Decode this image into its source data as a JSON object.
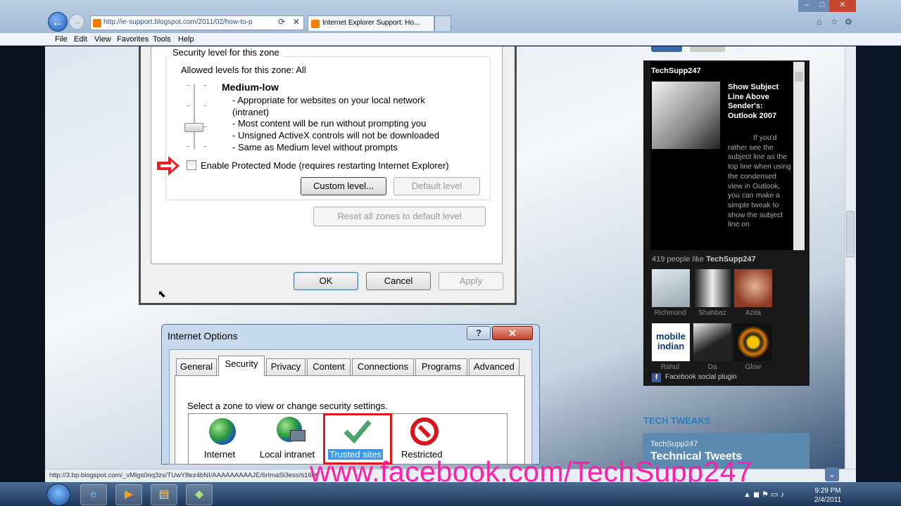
{
  "browser": {
    "address": "http://ie-support.blogspot.com/2011/02/how-to-p",
    "tab_title": "Internet Explorer Support: Ho...",
    "menu": [
      "File",
      "Edit",
      "View",
      "Favorites",
      "Tools",
      "Help"
    ],
    "window_controls": [
      "minimize-icon",
      "maximize-icon",
      "close-icon"
    ]
  },
  "dialog1": {
    "group_title": "Security level for this zone",
    "allowed": "Allowed levels for this zone: All",
    "level_name": "Medium-low",
    "bullets": [
      "- Appropriate for websites on your local network",
      "(intranet)",
      "- Most content will be run without prompting you",
      "- Unsigned ActiveX controls will not be downloaded",
      "- Same as Medium level without prompts"
    ],
    "checkbox_label": "Enable Protected Mode (requires restarting Internet Explorer)",
    "custom_level": "Custom level...",
    "default_level": "Default level",
    "reset_all": "Reset all zones to default level",
    "ok": "OK",
    "cancel": "Cancel",
    "apply": "Apply"
  },
  "dialog2": {
    "title": "Internet Options",
    "help": "?",
    "close": "✕",
    "tabs": [
      "General",
      "Security",
      "Privacy",
      "Content",
      "Connections",
      "Programs",
      "Advanced"
    ],
    "prompt": "Select a zone to view or change security settings.",
    "zones": [
      "Internet",
      "Local intranet",
      "Trusted sites",
      "Restricted"
    ]
  },
  "sidebar": {
    "fb_title": "TechSupp247",
    "post_title": "Show Subject Line Above Sender's: Outlook 2007",
    "post_body": "If you'd rather see the subject line as the top line when using the condensed view in Outlook, you can make a simple tweak to show the subject line on",
    "likes_count": "419 people like",
    "likes_page": "TechSupp247",
    "fans": [
      "Richmond",
      "Shahbaz",
      "Azita",
      "Rahul",
      "Da",
      "Glow"
    ],
    "fan_tile_text": "mobile indian",
    "plugin_label": "Facebook social plugin",
    "tech_tweaks": "TECH TWEAKS",
    "tw_user": "TechSupp247",
    "tw_title": "Technical Tweets"
  },
  "status": {
    "url": "http://3.bp.blogspot.com/_vMlgs0nq3zs/TUwY8ez4bNI/AAAAAAAAAJE/6rImaSi3ess/s1600/Internet..."
  },
  "watermark": "www.facebook.com/TechSupp247",
  "taskbar": {
    "time": "9:29 PM",
    "date": "2/4/2011"
  }
}
